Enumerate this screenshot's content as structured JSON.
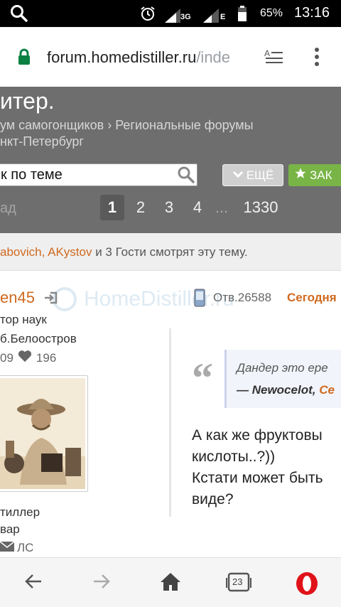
{
  "status_bar": {
    "battery_percent": "65%",
    "time": "13:16",
    "network_label": "3G",
    "network_label_2": "E"
  },
  "browser": {
    "url_host": "forum.homedistiller.ru",
    "url_rest": "/inde"
  },
  "topic": {
    "title": "итер.",
    "breadcrumb_line1": "ум самогонщиков › Региональные форумы",
    "breadcrumb_line2": "нкт-Петербург",
    "search_placeholder": "к по теме",
    "more_button": "ЕЩЁ",
    "bookmark_button": "ЗАК",
    "prev_label": "ад",
    "pages": [
      "1",
      "2",
      "3",
      "4",
      "...",
      "1330"
    ],
    "current_page": "1"
  },
  "viewers": {
    "users": "abovich, AKystov",
    "rest": " и 3 Гости смотрят эту тему."
  },
  "watermark": "HomeDistiller.ru",
  "post": {
    "author": "en45",
    "answer_label": "Отв.26588",
    "date": "Сегодня",
    "rank": "тор наук",
    "location": "б.Белоостров",
    "posts_count": "09",
    "likes": "196",
    "role": "тиллер",
    "equipment": "вар",
    "pm_label": "ЛС",
    "quote_text": "Дандер это ере",
    "quote_author": "— Newocelot, ",
    "quote_suffix": "Се",
    "body_lines": [
      "А как же фруктовы",
      "кислоты..?))",
      "Кстати может быть",
      "виде?"
    ]
  },
  "bottom_nav": {
    "tabs_count": "23"
  },
  "colors": {
    "accent_orange": "#d0691f",
    "header_gray": "#6e6e6e",
    "bookmark_green": "#79b447"
  }
}
